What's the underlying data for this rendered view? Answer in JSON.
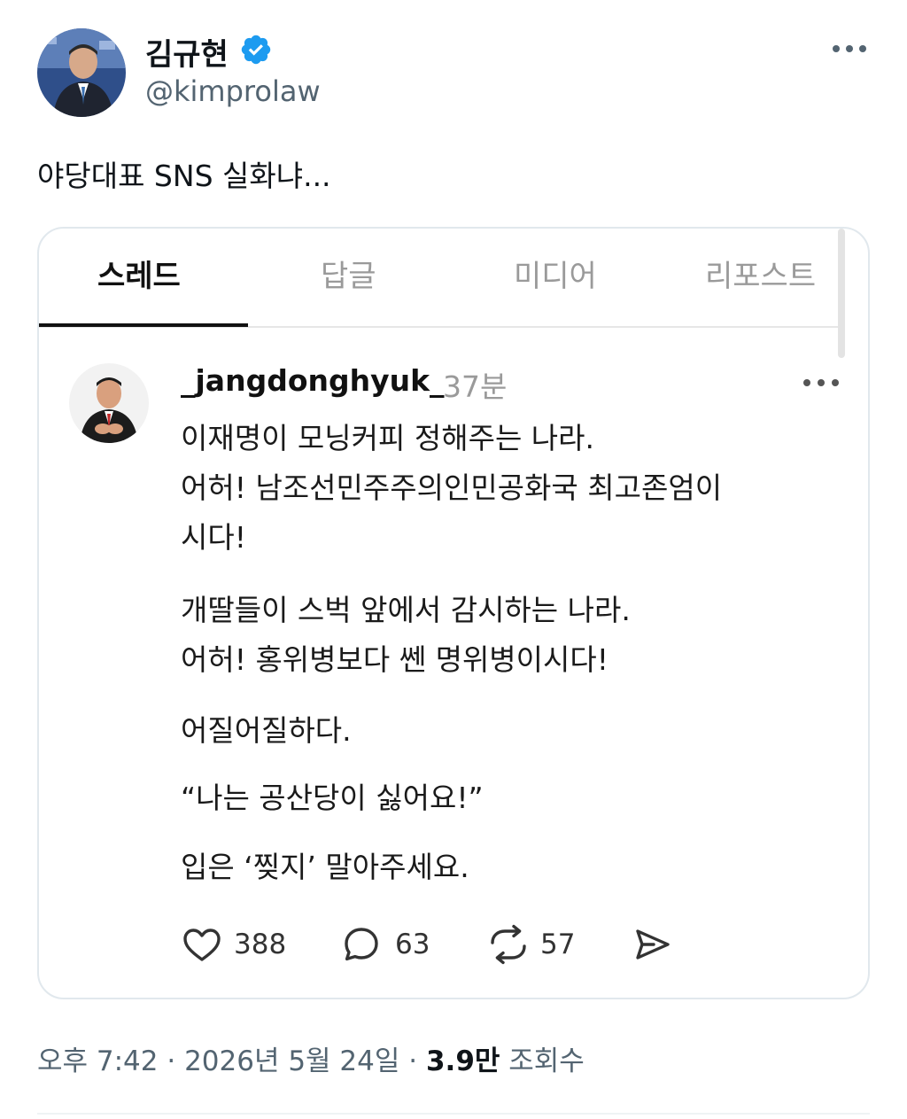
{
  "author": {
    "name": "김규현",
    "handle": "@kimprolaw"
  },
  "tweet": {
    "text": "야당대표 SNS 실화냐..."
  },
  "embedded": {
    "tabs": [
      {
        "label": "스레드",
        "active": true
      },
      {
        "label": "답글",
        "active": false
      },
      {
        "label": "미디어",
        "active": false
      },
      {
        "label": "리포스트",
        "active": false
      }
    ],
    "post": {
      "username": "_jangdonghyuk_",
      "time": "37분",
      "lines": [
        "이재명이 모닝커피 정해주는 나라.",
        "어허! 남조선민주주의인민공화국 최고존엄이",
        "시다!",
        "개딸들이 스벅 앞에서 감시하는 나라.",
        "어허! 홍위병보다 쎈 명위병이시다!",
        "어질어질하다.",
        "“나는 공산당이 싫어요!”",
        "입은 ‘찢지’ 말아주세요."
      ],
      "likes": "388",
      "comments": "63",
      "reposts": "57"
    }
  },
  "meta": {
    "time": "오후 7:42 · 2026년 5월 24일 · ",
    "views_count": "3.9만",
    "views_label": " 조회수"
  },
  "colors": {
    "verified": "#1d9bf0",
    "secondary_text": "#536471",
    "card_border": "#e1e8ed"
  }
}
